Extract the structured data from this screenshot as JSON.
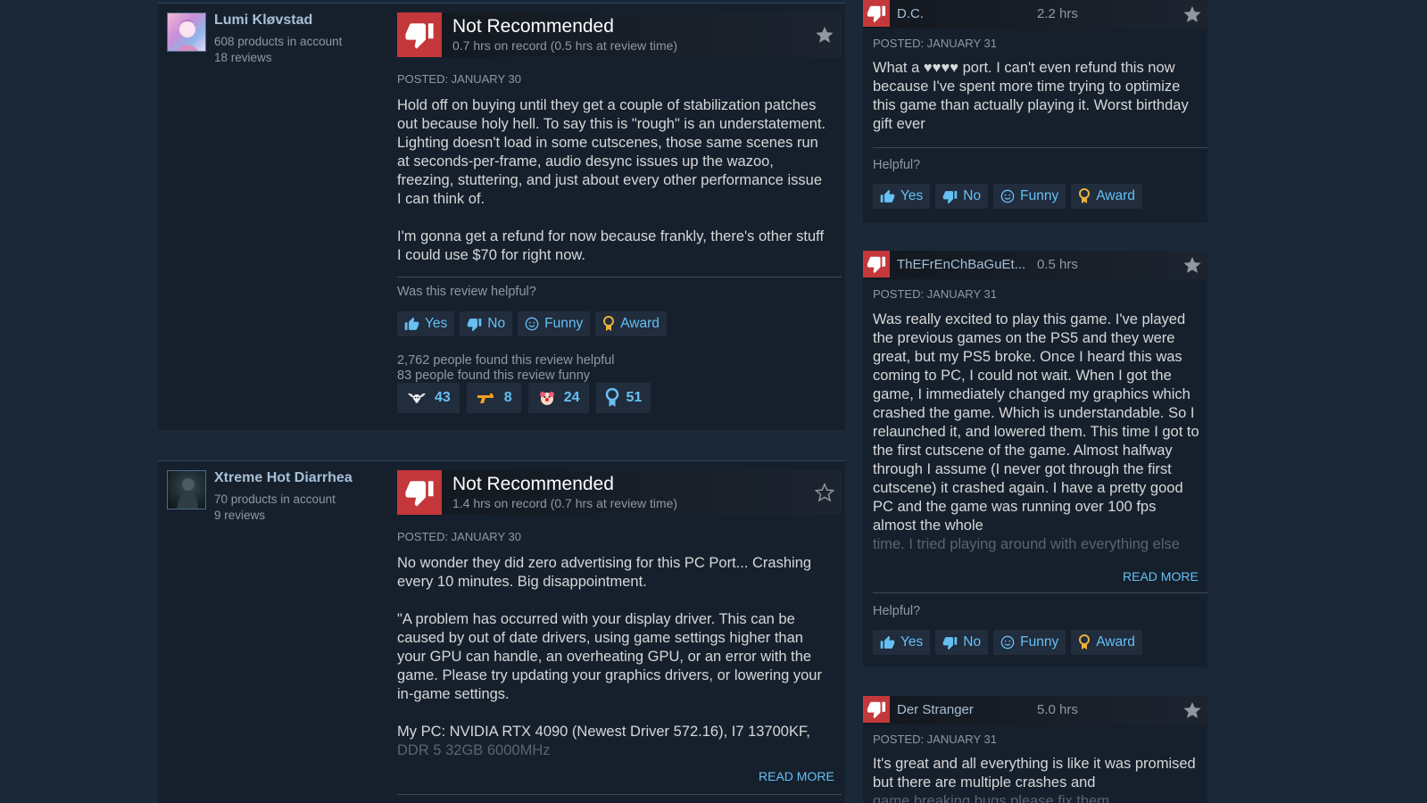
{
  "reviews": [
    {
      "author": "Lumi Kløvstad",
      "products": "608 products in account",
      "review_count": "18 reviews",
      "verdict": "Not Recommended",
      "hours": "0.7 hrs on record (0.5 hrs at review time)",
      "posted": "POSTED: JANUARY 30",
      "paragraphs": [
        "Hold off on buying until they get a couple of stabilization patches out because holy hell. To say this is \"rough\" is an understatement. Lighting doesn't load in some cutscenes, those same scenes run at seconds-per-frame, audio desync issues up the wazoo, freezing, stuttering, and just about every other performance issue I can think of.",
        "I'm gonna get a refund for now because frankly, there's other stuff I could use $70 for right now."
      ],
      "helpful_question": "Was this review helpful?",
      "buttons": {
        "yes": "Yes",
        "no": "No",
        "funny": "Funny",
        "award": "Award"
      },
      "helpful_count": "2,762 people found this review helpful",
      "funny_count": "83 people found this review funny",
      "awards": [
        {
          "icon": "winged-skull-award-icon",
          "count": "43"
        },
        {
          "icon": "pistol-award-icon",
          "count": "8"
        },
        {
          "icon": "clown-award-icon",
          "count": "24"
        },
        {
          "icon": "ribbon-award-icon",
          "count": "51"
        }
      ]
    },
    {
      "author": "Xtreme Hot Diarrhea",
      "products": "70 products in account",
      "review_count": "9 reviews",
      "verdict": "Not Recommended",
      "hours": "1.4 hrs on record (0.7 hrs at review time)",
      "posted": "POSTED: JANUARY 30",
      "paragraphs": [
        "No wonder they did zero advertising for this PC Port... Crashing every 10 minutes. Big disappointment.",
        "\"A problem has occurred with your display driver. This can be caused by out of date drivers, using game settings higher than your GPU can handle, an overheating GPU, or an error with the game. Please try updating your graphics drivers, or lowering your in-game settings.",
        "My PC: NVIDIA RTX 4090 (Newest Driver 572.16), I7 13700KF,"
      ],
      "faded_line": "DDR 5 32GB 6000MHz",
      "read_more": "READ MORE"
    }
  ],
  "side_reviews": [
    {
      "author": "D.C.",
      "hours": "2.2 hrs",
      "posted": "POSTED: JANUARY 31",
      "text": "What a ♥♥♥♥ port. I can't even refund this now because I've spent more time trying to optimize this game than actually playing it. Worst birthday gift ever",
      "helpful_question": "Helpful?",
      "buttons": {
        "yes": "Yes",
        "no": "No",
        "funny": "Funny",
        "award": "Award"
      }
    },
    {
      "author": "ThEFrEnChBaGuEt...",
      "hours": "0.5 hrs",
      "posted": "POSTED: JANUARY 31",
      "text": "Was really excited to play this game. I've played the previous games on the PS5 and they were great, but my PS5 broke. Once I heard this was coming to PC, I could not wait. When I got the game, I immediately changed my graphics which crashed the game. Which is understandable. So I relaunched it, and lowered them. This time I got to the first cutscene of the game. Almost halfway through I assume (I never got through the first cutscene) it crashed again. I have a pretty good PC and the game was running over 100 fps almost the whole",
      "faded_line": "time. I tried playing around with everything else",
      "read_more": "READ MORE",
      "helpful_question": "Helpful?",
      "buttons": {
        "yes": "Yes",
        "no": "No",
        "funny": "Funny",
        "award": "Award"
      }
    },
    {
      "author": "Der Stranger",
      "hours": "5.0 hrs",
      "posted": "POSTED: JANUARY 31",
      "text": "It's great and all everything is like it was promised but there are multiple crashes and",
      "faded_line": "game breaking bugs please fix them"
    }
  ],
  "colors": {
    "background": "#1b2838",
    "card": "#16202d",
    "thumb_down": "#c4373a",
    "link": "#66c0f4",
    "award_gold": "#e8b23a"
  }
}
